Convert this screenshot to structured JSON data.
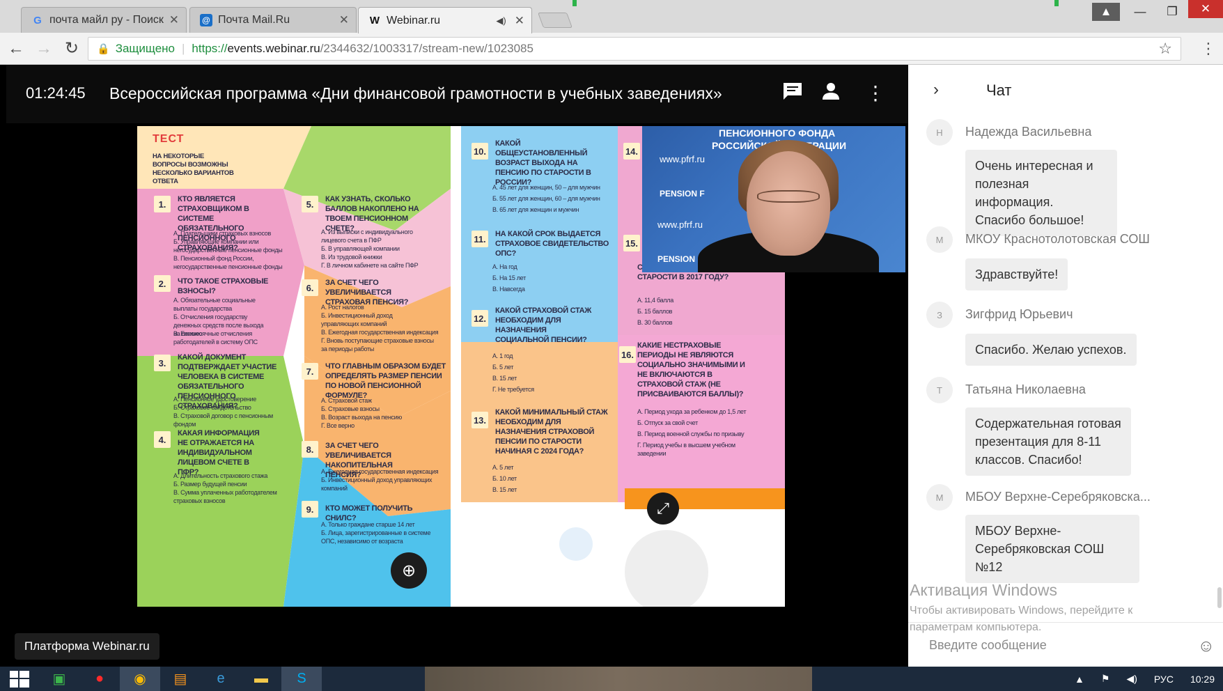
{
  "browser": {
    "tabs": [
      {
        "title": "почта майл ру - Поиск в",
        "icon": "google-icon"
      },
      {
        "title": "Почта Mail.Ru",
        "icon": "mailru-icon"
      },
      {
        "title": "Webinar.ru",
        "icon": "webinar-w-icon",
        "audio": true
      }
    ],
    "secure_label": "Защищено",
    "url_scheme": "https://",
    "url_host": "events.webinar.ru",
    "url_path": "/2344632/1003317/stream-new/1023085"
  },
  "webinar": {
    "timer": "01:24:45",
    "title": "Всероссийская программа «Дни финансовой грамотности в учебных заведениях»",
    "platform_label": "Платформа Webinar.ru"
  },
  "slide": {
    "test_title": "ТЕСТ",
    "intro": "НА НЕКОТОРЫЕ ВОПРОСЫ ВОЗМОЖНЫ НЕСКОЛЬКО ВАРИАНТОВ ОТВЕТА",
    "questions": [
      {
        "n": "1.",
        "q": "КТО ЯВЛЯЕТСЯ СТРАХОВЩИКОМ В СИСТЕМЕ ОБЯЗАТЕЛЬНОГО ПЕНСИОННОГО СТРАХОВАНИЯ?",
        "a": [
          "А. Плательщики страховых взносов",
          "Б. Управляющие компании или негосударственные пенсионные фонды",
          "В. Пенсионный фонд России, негосударственные пенсионные фонды"
        ]
      },
      {
        "n": "2.",
        "q": "ЧТО ТАКОЕ СТРАХОВЫЕ ВЗНОСЫ?",
        "a": [
          "А. Обязательные социальные выплаты государства",
          "Б. Отчисления государству денежных средств после выхода на пенсию",
          "В. Ежемесячные отчисления работодателей в систему ОПС"
        ]
      },
      {
        "n": "3.",
        "q": "КАКОЙ ДОКУМЕНТ ПОДТВЕРЖДАЕТ УЧАСТИЕ ЧЕЛОВЕКА В СИСТЕМЕ ОБЯЗАТЕЛЬНОГО ПЕНСИОННОГО СТРАХОВАНИЯ?",
        "a": [
          "А. Пенсионное удостоверение",
          "Б. Страховое свидетельство",
          "В. Страховой договор с пенсионным фондом"
        ]
      },
      {
        "n": "4.",
        "q": "КАКАЯ ИНФОРМАЦИЯ НЕ ОТРАЖАЕТСЯ НА ИНДИВИДУАЛЬНОМ ЛИЦЕВОМ СЧЕТЕ В ПФР?",
        "a": [
          "А. Длительность страхового стажа",
          "Б. Размер будущей пенсии",
          "В. Сумма уплаченных работодателем страховых взносов"
        ]
      },
      {
        "n": "5.",
        "q": "КАК УЗНАТЬ, СКОЛЬКО БАЛЛОВ НАКОПЛЕНО НА ТВОЕМ ПЕНСИОННОМ СЧЕТЕ?",
        "a": [
          "А. Из выписки с индивидуального лицевого счета в ПФР",
          "Б. В управляющей компании",
          "В. Из трудовой книжки",
          "Г. В личном кабинете на сайте ПФР"
        ]
      },
      {
        "n": "6.",
        "q": "ЗА СЧЕТ ЧЕГО УВЕЛИЧИВАЕТСЯ СТРАХОВАЯ ПЕНСИЯ?",
        "a": [
          "А. Рост налогов",
          "Б. Инвестиционный доход управляющих компаний",
          "В. Ежегодная государственная индексация",
          "Г. Вновь поступающие страховые взносы за периоды работы"
        ]
      },
      {
        "n": "7.",
        "q": "ЧТО ГЛАВНЫМ ОБРАЗОМ БУДЕТ ОПРЕДЕЛЯТЬ РАЗМЕР ПЕНСИИ ПО НОВОЙ ПЕНСИОННОЙ ФОРМУЛЕ?",
        "a": [
          "А. Страховой стаж",
          "Б. Страховые взносы",
          "В. Возраст выхода на пенсию",
          "Г. Все верно"
        ]
      },
      {
        "n": "8.",
        "q": "ЗА СЧЕТ ЧЕГО УВЕЛИЧИВАЕТСЯ НАКОПИТЕЛЬНАЯ ПЕНСИЯ?",
        "a": [
          "А. Ежегодная государственная индексация",
          "Б. Инвестиционный доход управляющих компаний"
        ]
      },
      {
        "n": "9.",
        "q": "КТО МОЖЕТ ПОЛУЧИТЬ СНИЛС?",
        "a": [
          "А. Только граждане старше 14 лет",
          "Б. Лица, зарегистрированные в системе ОПС, независимо от возраста"
        ]
      },
      {
        "n": "10.",
        "q": "КАКОЙ ОБЩЕУСТАНОВЛЕННЫЙ ВОЗРАСТ ВЫХОДА НА ПЕНСИЮ ПО СТАРОСТИ В РОССИИ?",
        "a": [
          "А. 45 лет для женщин, 50 – для мужчин",
          "Б. 55 лет для женщин, 60 – для мужчин",
          "В. 65 лет для женщин и мужчин"
        ]
      },
      {
        "n": "11.",
        "q": "НА КАКОЙ СРОК ВЫДАЕТСЯ СТРАХОВОЕ СВИДЕТЕЛЬСТВО ОПС?",
        "a": [
          "А. На год",
          "Б. На 15 лет",
          "В. Навсегда"
        ]
      },
      {
        "n": "12.",
        "q": "КАКОЙ СТРАХОВОЙ СТАЖ НЕОБХОДИМ ДЛЯ НАЗНАЧЕНИЯ СОЦИАЛЬНОЙ ПЕНСИИ?",
        "a": [
          "А. 1 год",
          "Б. 5 лет",
          "В. 15 лет",
          "Г. Не требуется"
        ]
      },
      {
        "n": "13.",
        "q": "КАКОЙ МИНИМАЛЬНЫЙ СТАЖ НЕОБХОДИМ ДЛЯ НАЗНАЧЕНИЯ СТРАХОВОЙ ПЕНСИИ ПО СТАРОСТИ НАЧИНАЯ С 2024 ГОДА?",
        "a": [
          "А. 5 лет",
          "Б. 10 лет",
          "В. 15 лет"
        ]
      },
      {
        "n": "14.",
        "q": "",
        "a": []
      },
      {
        "n": "15.",
        "q": "СТРАХОВОЙ ПЕНСИИ ПО СТАРОСТИ В 2017 ГОДУ?",
        "a": [
          "А. 11,4 балла",
          "Б. 15 баллов",
          "В. 30 баллов"
        ]
      },
      {
        "n": "16.",
        "q": "КАКИЕ НЕСТРАХОВЫЕ ПЕРИОДЫ НЕ ЯВЛЯЮТСЯ СОЦИАЛЬНО ЗНАЧИМЫМИ И НЕ ВКЛЮЧАЮТСЯ В СТРАХОВОЙ СТАЖ (НЕ ПРИСВАИВАЮТСЯ БАЛЛЫ)?",
        "a": [
          "А. Период ухода за ребенком до 1,5 лет",
          "Б. Отпуск за свой счет",
          "В. Период военной службы по призыву",
          "Г. Период учебы в высшем учебном заведении"
        ]
      }
    ]
  },
  "webcam": {
    "lines": [
      "ПЕНСИОННОГО ФОНДА",
      "РОССИЙСКОЙ ФЕДЕРАЦИИ",
      "www.pfrf.ru",
      "PENSION F",
      "www.pfrf.ru",
      "PENSION"
    ]
  },
  "chat": {
    "title": "Чат",
    "messages": [
      {
        "initial": "Н",
        "author": "Надежда Васильевна",
        "text": [
          "Очень интересная и",
          "полезная информация.",
          "Спасибо большое!"
        ]
      },
      {
        "initial": "М",
        "author": "МКОУ Краснотолотовская СОШ",
        "text": [
          "Здравствуйте!"
        ]
      },
      {
        "initial": "З",
        "author": "Зигфрид Юрьевич",
        "text": [
          "Спасибо. Желаю успехов."
        ]
      },
      {
        "initial": "Т",
        "author": "Татьяна Николаевна",
        "text": [
          "Содержательная готовая",
          "презентация для 8-11",
          "классов. Спасибо!"
        ]
      },
      {
        "initial": "М",
        "author": "МБОУ Верхне-Серебряковска...",
        "text": [
          "МБОУ Верхне-",
          "Серебряковская СОШ №12"
        ]
      }
    ],
    "input_placeholder": "Введите сообщение"
  },
  "activation": {
    "line1": "Активация Windows",
    "line2": "Чтобы активировать Windows, перейдите к",
    "line3": "параметрам компьютера."
  },
  "taskbar": {
    "lang": "РУС",
    "time": "10:29"
  }
}
